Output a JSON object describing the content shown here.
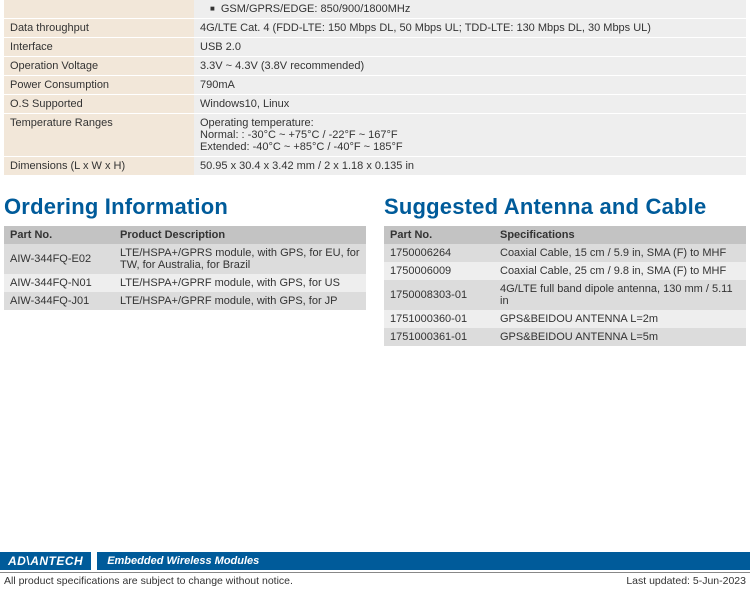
{
  "specs": {
    "gsm_bullet": "GSM/GPRS/EDGE: 850/900/1800MHz",
    "rows": [
      {
        "label": "Data throughput",
        "value": "4G/LTE Cat. 4 (FDD-LTE: 150 Mbps DL, 50 Mbps UL; TDD-LTE: 130 Mbps DL, 30 Mbps UL)"
      },
      {
        "label": "Interface",
        "value": "USB 2.0"
      },
      {
        "label": "Operation Voltage",
        "value": "3.3V ~ 4.3V (3.8V recommended)"
      },
      {
        "label": "Power Consumption",
        "value": "790mA"
      },
      {
        "label": "O.S Supported",
        "value": "Windows10, Linux"
      }
    ],
    "temp_label": "Temperature Ranges",
    "temp_lines": [
      "Operating temperature:",
      "Normal: : -30°C ~ +75°C / -22°F ~ 167°F",
      "Extended: -40°C ~ +85°C / -40°F ~ 185°F"
    ],
    "dim_label": "Dimensions (L x W x H)",
    "dim_value": "50.95 x 30.4 x 3.42 mm / 2 x 1.18 x 0.135 in"
  },
  "ordering": {
    "title": "Ordering Information",
    "headers": {
      "pn": "Part No.",
      "desc": "Product Description"
    },
    "rows": [
      {
        "pn": "AIW-344FQ-E02",
        "desc": "LTE/HSPA+/GPRS module, with GPS, for EU, for TW, for Australia, for Brazil"
      },
      {
        "pn": "AIW-344FQ-N01",
        "desc": "LTE/HSPA+/GPRF module, with GPS, for US"
      },
      {
        "pn": "AIW-344FQ-J01",
        "desc": "LTE/HSPA+/GPRF module, with GPS, for JP"
      }
    ]
  },
  "antenna": {
    "title": "Suggested Antenna and Cable",
    "headers": {
      "pn": "Part No.",
      "spec": "Specifications"
    },
    "rows": [
      {
        "pn": "1750006264",
        "spec": "Coaxial Cable, 15 cm / 5.9 in, SMA (F) to MHF"
      },
      {
        "pn": "1750006009",
        "spec": "Coaxial Cable, 25 cm / 9.8 in, SMA (F) to MHF"
      },
      {
        "pn": "1750008303-01",
        "spec": "4G/LTE full band dipole antenna, 130 mm / 5.11 in"
      },
      {
        "pn": "1751000360-01",
        "spec": "GPS&BEIDOU ANTENNA L=2m"
      },
      {
        "pn": "1751000361-01",
        "spec": "GPS&BEIDOU ANTENNA L=5m"
      }
    ]
  },
  "footer": {
    "brand": "ADVANTECH",
    "category": "Embedded Wireless Modules",
    "disclaimer": "All product specifications are subject to change without notice.",
    "updated": "Last updated: 5-Jun-2023"
  }
}
